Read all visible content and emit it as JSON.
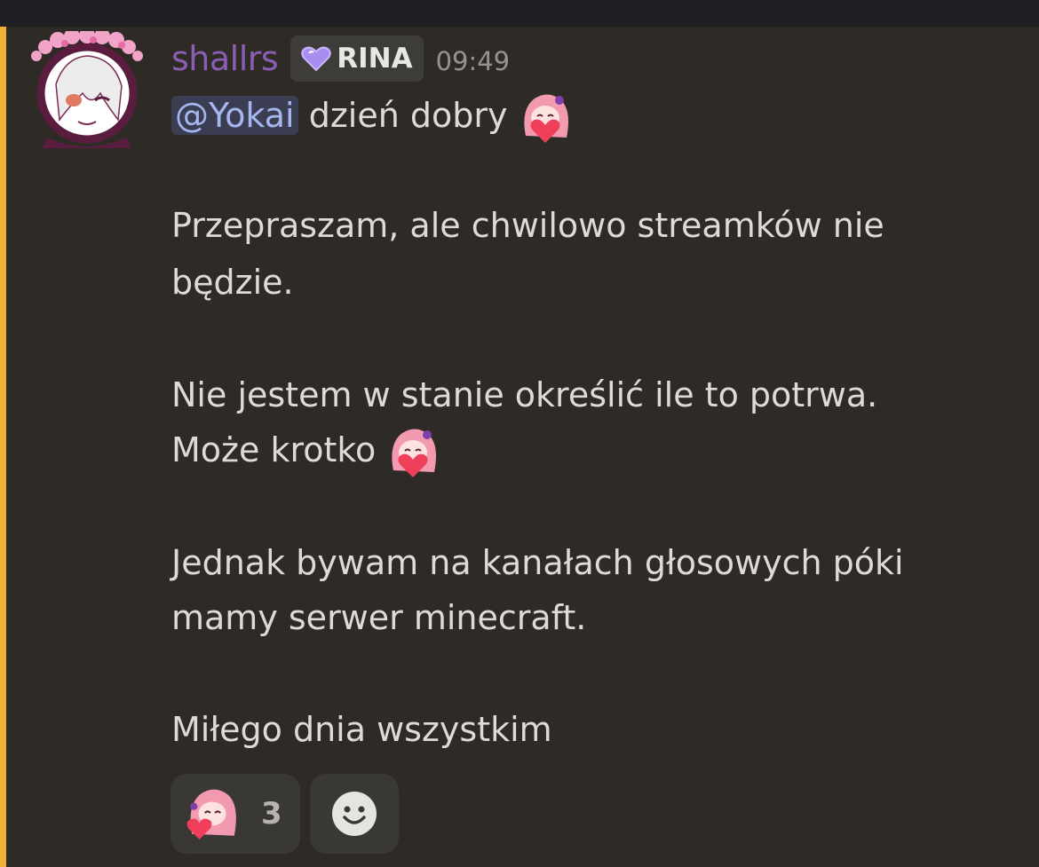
{
  "message": {
    "author": "shallrs",
    "role_tag": {
      "label": "RINA",
      "icon": "purple-heart-icon"
    },
    "timestamp": "09:49",
    "mention": "@Yokai",
    "line1_rest": "dzień dobry",
    "para1_line1": "Przepraszam, ale chwilowo streamków nie",
    "para1_line2": "będzie.",
    "para2_line1": "Nie jestem w stanie określić ile to potrwa.",
    "para2_line2": "Może krotko",
    "para3_line1": "Jednak bywam na kanałach głosowych póki",
    "para3_line2": "mamy serwer minecraft.",
    "para4_line1": "Miłego dnia wszystkim",
    "emoji": "anime-girl-heart-emoji"
  },
  "reactions": [
    {
      "emoji": "anime-girl-heart-emoji",
      "count": "3"
    }
  ],
  "add_reaction_icon": "smiley-face-icon",
  "colors": {
    "accent_bar": "#f0b232",
    "username": "#8a5fb3",
    "mention_bg": "#3b3e52",
    "mention_text": "#a5b7ee"
  }
}
